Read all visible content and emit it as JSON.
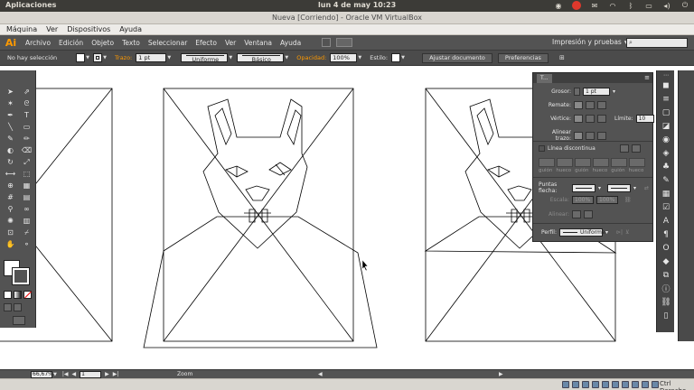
{
  "os_panel": {
    "apps_label": "Aplicaciones",
    "clock": "lun  4 de may 10:23",
    "tray_icons": [
      "chrome-icon",
      "stop-icon",
      "mail-icon",
      "wifi-icon",
      "bluetooth-icon",
      "battery-icon",
      "volume-icon",
      "power-icon"
    ]
  },
  "vbox": {
    "title": "Nueva [Corriendo] - Oracle VM VirtualBox",
    "menu": [
      "Máquina",
      "Ver",
      "Dispositivos",
      "Ayuda"
    ],
    "host_key": "Ctrl Derecho"
  },
  "ai": {
    "logo": "Ai",
    "menu": [
      "Archivo",
      "Edición",
      "Objeto",
      "Texto",
      "Seleccionar",
      "Efecto",
      "Ver",
      "Ventana",
      "Ayuda"
    ],
    "workspace": "Impresión y pruebas",
    "search_placeholder": ""
  },
  "control_bar": {
    "selection": "No hay selección",
    "trazo_label": "Trazo:",
    "trazo_value": "1 pt",
    "profile": "Uniforme",
    "brush": "Básico",
    "opacidad_label": "Opacidad:",
    "opacidad_value": "100%",
    "estilo_label": "Estilo:",
    "doc_button": "Ajustar documento",
    "prefs_button": "Preferencias"
  },
  "stroke_panel": {
    "tab": "T...",
    "grosor_label": "Grosor:",
    "grosor_value": "1 pt",
    "remate_label": "Remate:",
    "vertice_label": "Vértice:",
    "limite_label": "Límite:",
    "limite_value": "10",
    "limite_unit": "x",
    "alinear_label": "Alinear trazo:",
    "dashed_label": "Línea discontinua",
    "dash_labels": [
      "guión",
      "hueco",
      "guión",
      "hueco",
      "guión",
      "hueco"
    ],
    "arrowheads_label": "Puntas flecha:",
    "escala_label": "Escala:",
    "escala_values": [
      "100%",
      "100%"
    ],
    "alinear2_label": "Alinear:",
    "perfil_label": "Perfil:",
    "perfil_value": "Uniforme"
  },
  "status_bar": {
    "zoom": "66,67%",
    "page": "1",
    "zoom_label": "Zoom"
  },
  "colors": {
    "ai_panel": "#535353",
    "ai_accent": "#ff9a00",
    "ubuntu_panel": "#3c3b37"
  }
}
